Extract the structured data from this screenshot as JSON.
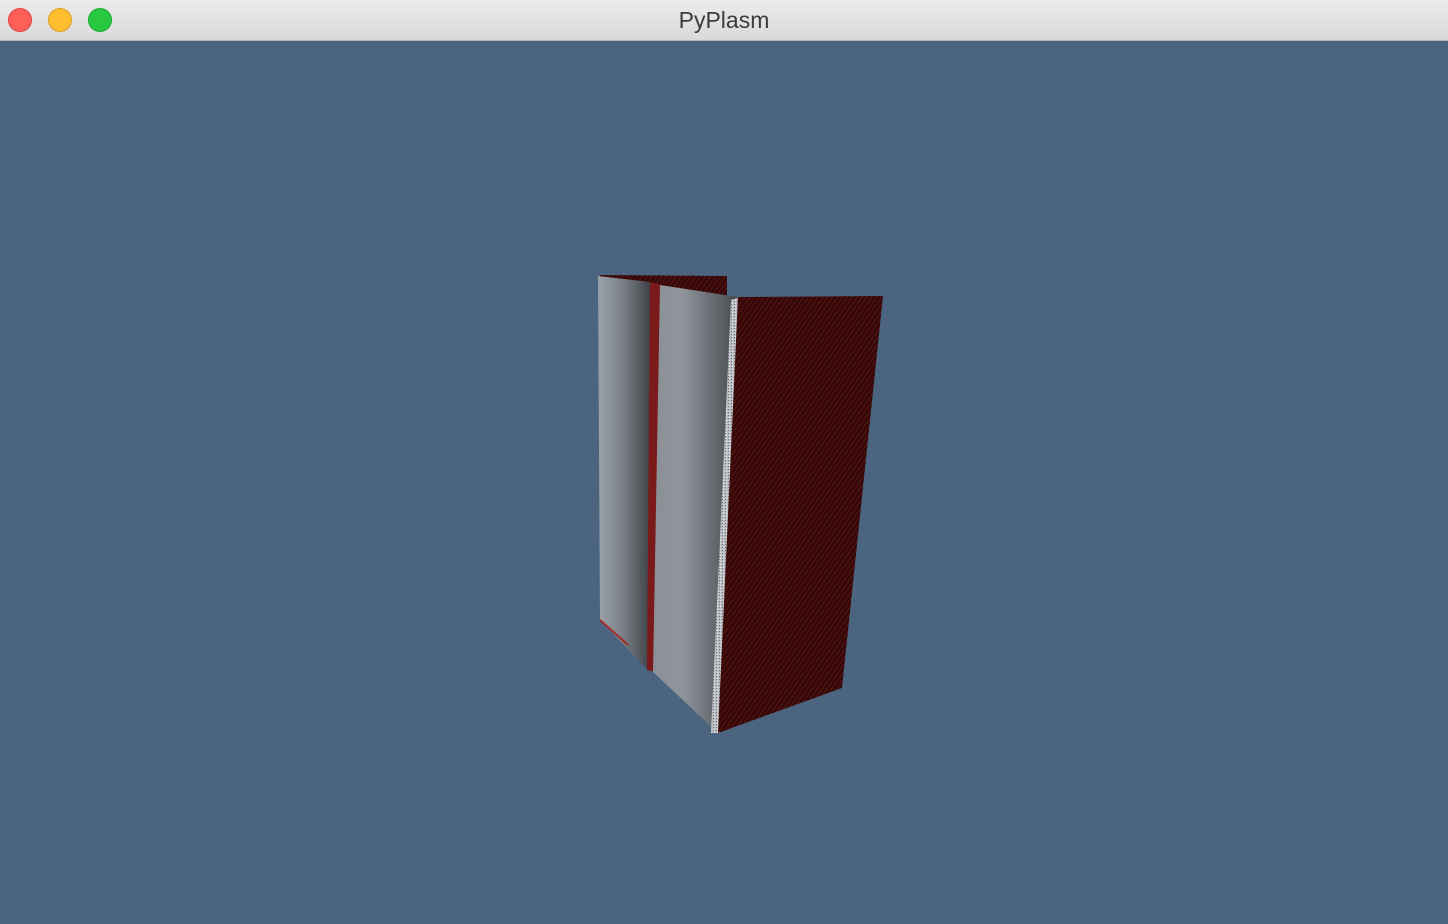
{
  "window": {
    "title": "PyPlasm",
    "controls": {
      "close": "close-window",
      "minimize": "minimize-window",
      "maximize": "zoom-window"
    }
  },
  "colors": {
    "viewport_background": "#4b6580",
    "metal_light": "#9aa1a8",
    "metal_dark": "#3e4347",
    "fabric": "#3a0a0a",
    "fabric_stripe": "#6e1a1a"
  }
}
